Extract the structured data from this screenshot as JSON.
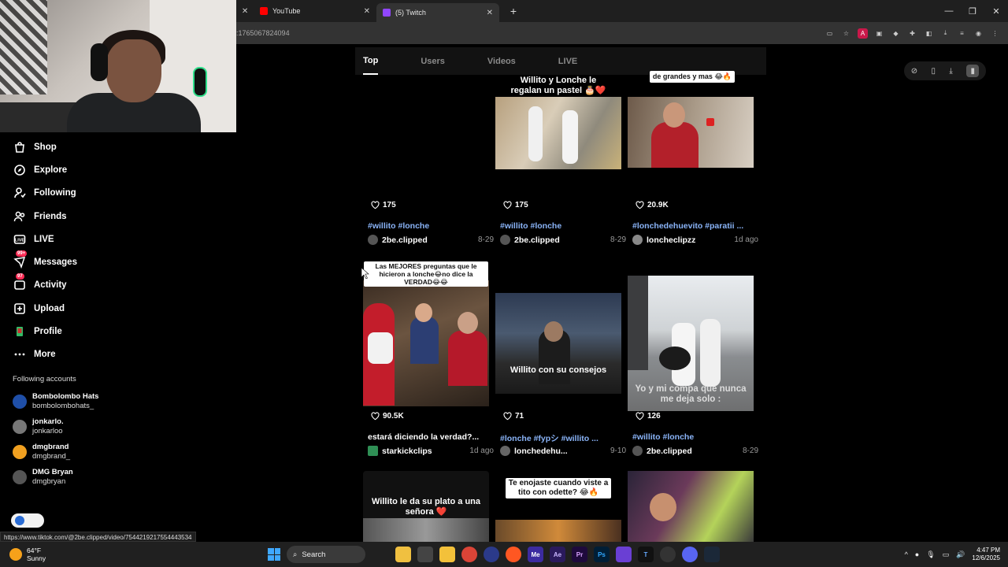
{
  "browser": {
    "tabs": [
      {
        "title": "YouTube",
        "color": "#ff0000"
      },
      {
        "title": "(5) Twitch",
        "color": "#9146ff"
      }
    ],
    "new_tab": "+",
    "url": ":1765067824094",
    "status_url": "https://www.tiktok.com/@2be.clipped/video/7544219217554443534"
  },
  "sidebar": {
    "items": [
      {
        "label": "Shop",
        "icon": "shop-icon"
      },
      {
        "label": "Explore",
        "icon": "explore-icon"
      },
      {
        "label": "Following",
        "icon": "following-icon"
      },
      {
        "label": "Friends",
        "icon": "friends-icon"
      },
      {
        "label": "LIVE",
        "icon": "live-icon"
      },
      {
        "label": "Messages",
        "icon": "messages-icon",
        "badge": "99+"
      },
      {
        "label": "Activity",
        "icon": "activity-icon",
        "badge": "97"
      },
      {
        "label": "Upload",
        "icon": "upload-icon"
      },
      {
        "label": "Profile",
        "icon": "profile-icon"
      },
      {
        "label": "More",
        "icon": "more-icon"
      }
    ],
    "following_title": "Following accounts",
    "accounts": [
      {
        "name": "Bombolombo Hats",
        "handle": "bombolombohats_",
        "color": "#1f4fa8"
      },
      {
        "name": "jonkarlo.",
        "handle": "jonkarloo",
        "color": "#777777"
      },
      {
        "name": "dmgbrand",
        "handle": "dmgbrand_",
        "color": "#f0a020"
      },
      {
        "name": "DMG Bryan",
        "handle": "dmgbryan",
        "color": "#555555"
      }
    ]
  },
  "search_tabs": [
    "Top",
    "Users",
    "Videos",
    "LIVE"
  ],
  "videos": [
    {
      "likes": "175",
      "caption": "#willito #lonche",
      "author": "2be.clipped",
      "date": "8-29",
      "overlay": ""
    },
    {
      "likes": "175",
      "caption": "#willito #lonche",
      "author": "2be.clipped",
      "date": "8-29",
      "overlay": "Willito y Lonche le regalan un pastel 🎂❤️"
    },
    {
      "likes": "20.9K",
      "caption": "#lonchedehuevito #paratii ...",
      "author": "loncheclipzz",
      "date": "1d ago",
      "overlay": "de grandes y mas 😂🔥"
    },
    {
      "likes": "90.5K",
      "caption": "estará diciendo la verdad?...",
      "author": "starkickclips",
      "date": "1d ago",
      "overlay": "Las MEJORES preguntas que le hicieron a lonche😂no dice la VERDAD😂😂"
    },
    {
      "likes": "71",
      "caption": "#lonche #fypシ #willito ...",
      "author": "lonchedehu...",
      "date": "9-10",
      "overlay": "Willito con su consejos"
    },
    {
      "likes": "126",
      "caption": "#willito #lonche",
      "author": "2be.clipped",
      "date": "8-29",
      "overlay": "Yo y mi compa que nunca me deja solo :"
    },
    {
      "overlay": "Willito le da su plato a una señora ❤️"
    },
    {
      "overlay": "Te enojaste cuando viste a tito con odette? 😂🔥"
    },
    {
      "overlay": ""
    }
  ],
  "taskbar": {
    "temp": "64°F",
    "weather": "Sunny",
    "search": "Search",
    "time": "4:47 PM",
    "date": "12/6/2025",
    "apps": [
      "Me",
      "Ae",
      "Pr",
      "Ps"
    ]
  }
}
